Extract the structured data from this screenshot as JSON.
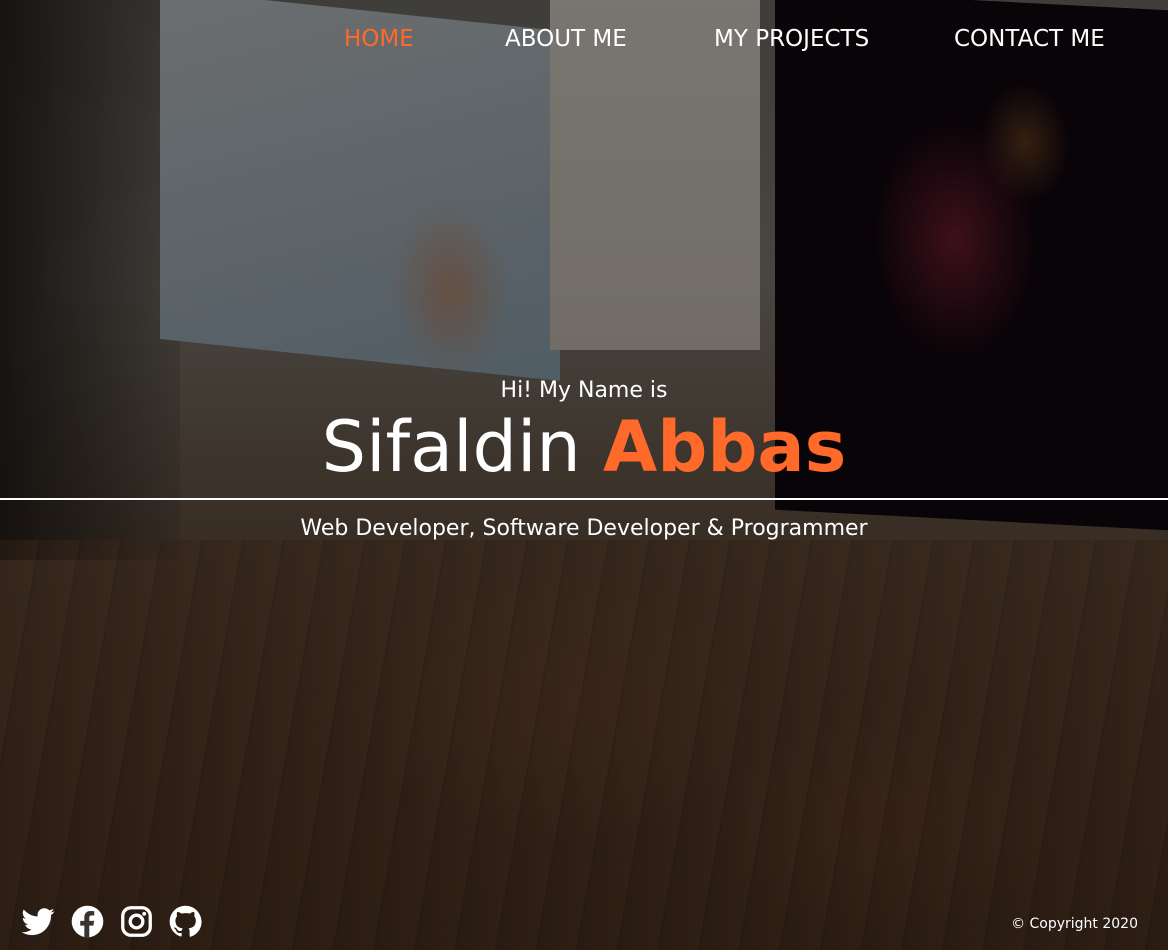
{
  "nav": {
    "items": [
      {
        "label": "HOME",
        "active": true
      },
      {
        "label": "ABOUT ME",
        "active": false
      },
      {
        "label": "MY PROJECTS",
        "active": false
      },
      {
        "label": "CONTACT ME",
        "active": false
      }
    ]
  },
  "hero": {
    "greeting": "Hi! My Name is",
    "first_name": "Sifaldin",
    "last_name": "Abbas",
    "tagline": "Web Developer, Software Developer & Programmer"
  },
  "footer": {
    "social": [
      {
        "icon": "twitter-icon"
      },
      {
        "icon": "facebook-icon"
      },
      {
        "icon": "instagram-icon"
      },
      {
        "icon": "github-icon"
      }
    ],
    "copyright": "© Copyright 2020"
  },
  "colors": {
    "accent": "#ff6a2b",
    "text": "#ffffff"
  }
}
